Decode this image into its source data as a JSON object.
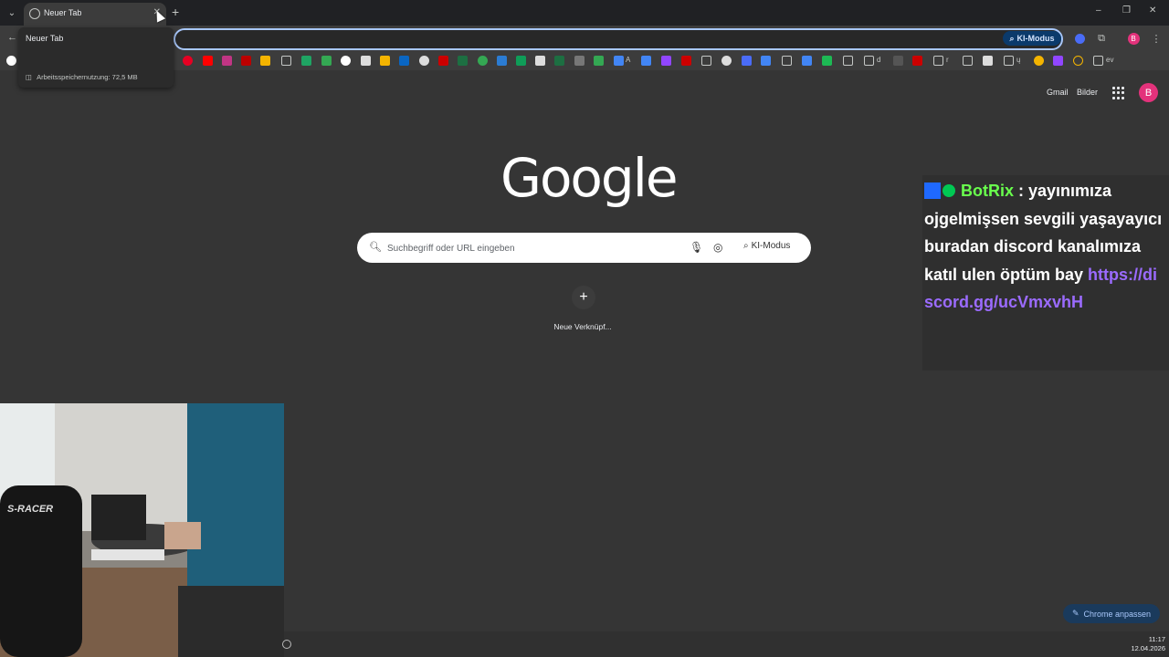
{
  "browser": {
    "tab_title": "Neuer Tab",
    "window_controls": {
      "minimize": "–",
      "restore": "❐",
      "close": "✕"
    }
  },
  "tab_hovercard": {
    "title": "Neuer Tab",
    "memory_usage": "Arbeitsspeichernutzung: 72,5 MB"
  },
  "toolbar": {
    "ki_mode_label": "KI-Modus",
    "profile_initial": "B"
  },
  "bookmarks": {
    "labels": [
      "A",
      "d",
      "r",
      "ų",
      "ev"
    ]
  },
  "ntp": {
    "gmail_label": "Gmail",
    "images_label": "Bilder",
    "profile_initial": "B",
    "logo_text": "Google",
    "search_placeholder": "Suchbegriff oder URL eingeben",
    "search_ki_label": "KI-Modus",
    "shortcut_label": "Neue Verknüpf...",
    "customize_label": "Chrome anpassen"
  },
  "chat_overlay": {
    "username": "BotRix",
    "message": " : yayınımıza ojgelmişsen sevgili yaşayayıcı buradan discord kanalımıza katıl ulen öptüm bay ",
    "link": "https://discord.gg/ucVmxvhH"
  },
  "webcam": {
    "chair_brand": "S-RACER"
  },
  "clock": {
    "time": "11:17",
    "date": "12.04.2026"
  },
  "colors": {
    "page_bg": "#353535",
    "chrome_bg": "#3c3c3c",
    "accent_blue": "#a8c7fa",
    "chat_username": "#69ff4d",
    "chat_link": "#9b6bff",
    "avatar": "#e3327b"
  }
}
